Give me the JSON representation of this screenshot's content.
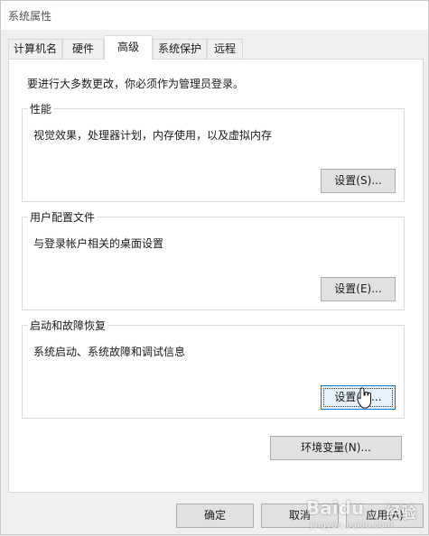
{
  "window": {
    "title": "系统属性"
  },
  "tabs": [
    {
      "label": "计算机名"
    },
    {
      "label": "硬件"
    },
    {
      "label": "高级"
    },
    {
      "label": "系统保护"
    },
    {
      "label": "远程"
    }
  ],
  "active_tab": "高级",
  "admin_note": "要进行大多数更改，你必须作为管理员登录。",
  "groups": {
    "performance": {
      "title": "性能",
      "description": "视觉效果，处理器计划，内存使用，以及虚拟内存",
      "button_label": "设置(S)..."
    },
    "user_profiles": {
      "title": "用户配置文件",
      "description": "与登录帐户相关的桌面设置",
      "button_label": "设置(E)..."
    },
    "startup_recovery": {
      "title": "启动和故障恢复",
      "description": "系统启动、系统故障和调试信息",
      "button_label": "设置(T)..."
    }
  },
  "env_vars_label": "环境变量(N)...",
  "footer": {
    "ok_label": "确定",
    "cancel_label": "取消",
    "apply_label": "应用(A)"
  },
  "watermark": {
    "brand": "Baidu",
    "jingyan": "经验",
    "url": "jingyan.baidu.com"
  },
  "colors": {
    "focus_border": "#0078d7",
    "button_bg": "#e1e1e1",
    "window_bg": "#f0f0f0"
  }
}
